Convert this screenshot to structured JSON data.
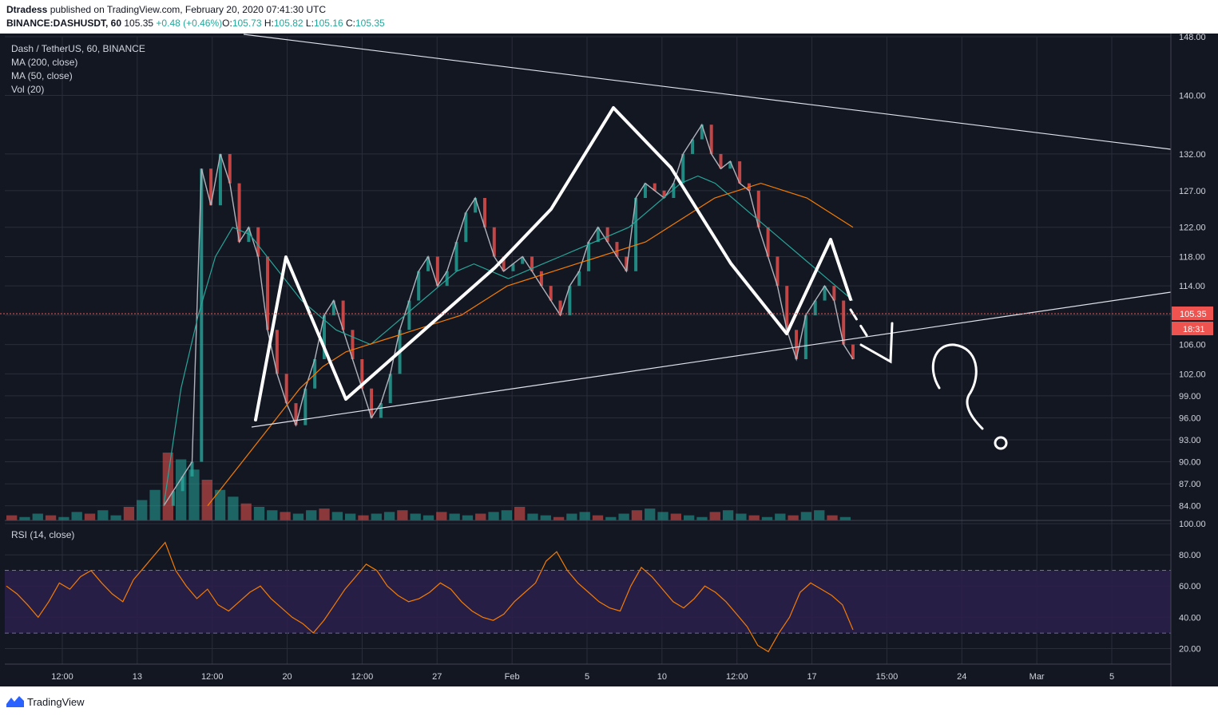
{
  "header": {
    "publisher": "Dtradess",
    "published_text": "published on TradingView.com, February 20, 2020 07:41:30 UTC",
    "symbol": "BINANCE:DASHUSDT, 60",
    "price": "105.35",
    "change": "+0.48 (+0.46%)",
    "o_label": "O:",
    "o_value": "105.73",
    "h_label": "H:",
    "h_value": "105.82",
    "l_label": "L:",
    "l_value": "105.16",
    "c_label": "C:",
    "c_value": "105.35"
  },
  "legend": {
    "title": "Dash / TetherUS, 60, BINANCE",
    "ma200": "MA (200, close)",
    "ma50": "MA (50, close)",
    "vol": "Vol (20)",
    "rsi": "RSI (14, close)"
  },
  "price_badge": "105.35",
  "time_badge": "18:31",
  "footer": {
    "brand": "TradingView"
  },
  "colors": {
    "background": "#131722",
    "up": "#26a69a",
    "down": "#ef5350",
    "ma50": "#26a69a",
    "ma200": "#f57c00",
    "rsi": "#f57c00",
    "rsi_band": "#2a1f4a"
  },
  "chart_data": [
    {
      "type": "line",
      "panel": "price",
      "price_axis_ticks": [
        "148.00",
        "140.00",
        "132.00",
        "127.00",
        "122.00",
        "118.00",
        "114.00",
        "110.00",
        "106.00",
        "102.00",
        "99.00",
        "96.00",
        "93.00",
        "90.00",
        "87.00",
        "84.00"
      ],
      "time_axis_ticks": [
        "12:00",
        "13",
        "12:00",
        "20",
        "12:00",
        "27",
        "Feb",
        "5",
        "10",
        "12:00",
        "17",
        "15:00",
        "24",
        "Mar",
        "5"
      ],
      "ylim": [
        82,
        148
      ],
      "series": [
        {
          "values": [
            84,
            86,
            88,
            90,
            130,
            125,
            132,
            128,
            120,
            122,
            118,
            108,
            102,
            98,
            95,
            100,
            104,
            110,
            112,
            108,
            104,
            100,
            96,
            98,
            102,
            108,
            112,
            116,
            118,
            114,
            116,
            120,
            124,
            126,
            122,
            118,
            116,
            117,
            118,
            116,
            114,
            112,
            110,
            114,
            116,
            120,
            122,
            120,
            118,
            116,
            126,
            128,
            127,
            126,
            128,
            132,
            134,
            136,
            132,
            130,
            131,
            128,
            127,
            122,
            118,
            114,
            108,
            104,
            110,
            112,
            114,
            112,
            106,
            104
          ]
        },
        {
          "values": [
            84,
            100,
            110,
            118,
            122,
            121,
            118,
            115,
            112,
            110,
            108,
            107,
            106,
            108,
            110,
            112,
            114,
            116,
            117,
            116,
            115,
            116,
            117,
            118,
            119,
            120,
            121,
            122,
            124,
            126,
            128,
            129,
            128,
            126,
            124,
            122,
            120,
            118,
            116,
            114,
            112
          ]
        },
        {
          "values": [
            84,
            88,
            92,
            96,
            100,
            103,
            105,
            106,
            107,
            108,
            109,
            110,
            112,
            114,
            115,
            116,
            117,
            118,
            119,
            120,
            122,
            124,
            126,
            127,
            128,
            127,
            126,
            124,
            122
          ]
        }
      ]
    },
    {
      "type": "line",
      "panel": "rsi",
      "rsi_axis_ticks": [
        "100.00",
        "80.00",
        "60.00",
        "40.00",
        "20.00"
      ],
      "ylim": [
        10,
        100
      ],
      "band": [
        30,
        70
      ],
      "series": [
        {
          "values": [
            60,
            55,
            48,
            40,
            50,
            62,
            58,
            66,
            70,
            62,
            55,
            50,
            64,
            72,
            80,
            88,
            70,
            60,
            52,
            58,
            48,
            44,
            50,
            56,
            60,
            52,
            46,
            40,
            36,
            30,
            38,
            48,
            58,
            66,
            74,
            70,
            60,
            54,
            50,
            52,
            56,
            62,
            58,
            50,
            44,
            40,
            38,
            42,
            50,
            56,
            62,
            76,
            82,
            70,
            62,
            56,
            50,
            46,
            44,
            60,
            72,
            66,
            58,
            50,
            46,
            52,
            60,
            56,
            50,
            42,
            34,
            22,
            18,
            30,
            40,
            56,
            62,
            58,
            54,
            48,
            32
          ]
        }
      ]
    },
    {
      "type": "bar",
      "panel": "volume",
      "values": [
        3,
        2,
        4,
        3,
        2,
        5,
        4,
        6,
        3,
        8,
        12,
        18,
        40,
        36,
        30,
        24,
        18,
        14,
        10,
        8,
        6,
        5,
        4,
        6,
        7,
        5,
        4,
        3,
        4,
        5,
        6,
        4,
        3,
        5,
        4,
        3,
        4,
        5,
        6,
        8,
        4,
        3,
        2,
        4,
        5,
        3,
        2,
        4,
        6,
        7,
        5,
        4,
        3,
        2,
        5,
        6,
        4,
        3,
        2,
        4,
        3,
        5,
        6,
        3,
        2
      ]
    }
  ]
}
